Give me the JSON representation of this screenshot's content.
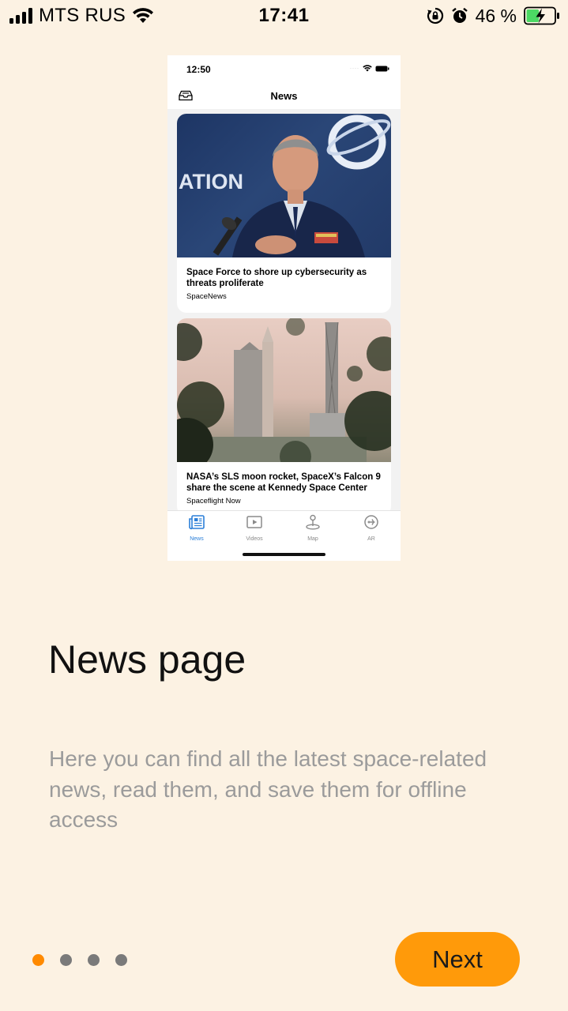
{
  "status_bar": {
    "carrier": "MTS RUS",
    "time": "17:41",
    "battery_percent": "46 %",
    "battery_level": 0.46,
    "icons": [
      "signal-icon",
      "wifi-icon",
      "orientation-lock-icon",
      "alarm-icon",
      "battery-charging-icon"
    ]
  },
  "preview": {
    "status_time": "12:50",
    "nav_title": "News",
    "articles": [
      {
        "title": "Space Force to shore up cybersecurity as threats proliferate",
        "source": "SpaceNews",
        "image_text": "ATION"
      },
      {
        "title": "NASA’s SLS moon rocket, SpaceX’s Falcon 9 share the scene at Kennedy Space Center",
        "source": "Spaceflight Now"
      }
    ],
    "tabs": [
      {
        "label": "News",
        "icon": "newspaper-icon",
        "active": true
      },
      {
        "label": "Videos",
        "icon": "play-icon",
        "active": false
      },
      {
        "label": "Map",
        "icon": "map-pin-icon",
        "active": false
      },
      {
        "label": "AR",
        "icon": "airplane-circle-icon",
        "active": false
      }
    ],
    "accent_color": "#2b7fd8"
  },
  "onboarding": {
    "title": "News page",
    "description": "Here you can find all the latest space-related news, read them, and save them for offline access",
    "page_count": 4,
    "current_page": 1,
    "next_label": "Next"
  },
  "colors": {
    "background": "#fcf2e3",
    "accent": "#ff9a0a",
    "active_dot": "#ff8a00",
    "inactive_dot": "#7a7a7a",
    "description_text": "#9b9b9b"
  }
}
